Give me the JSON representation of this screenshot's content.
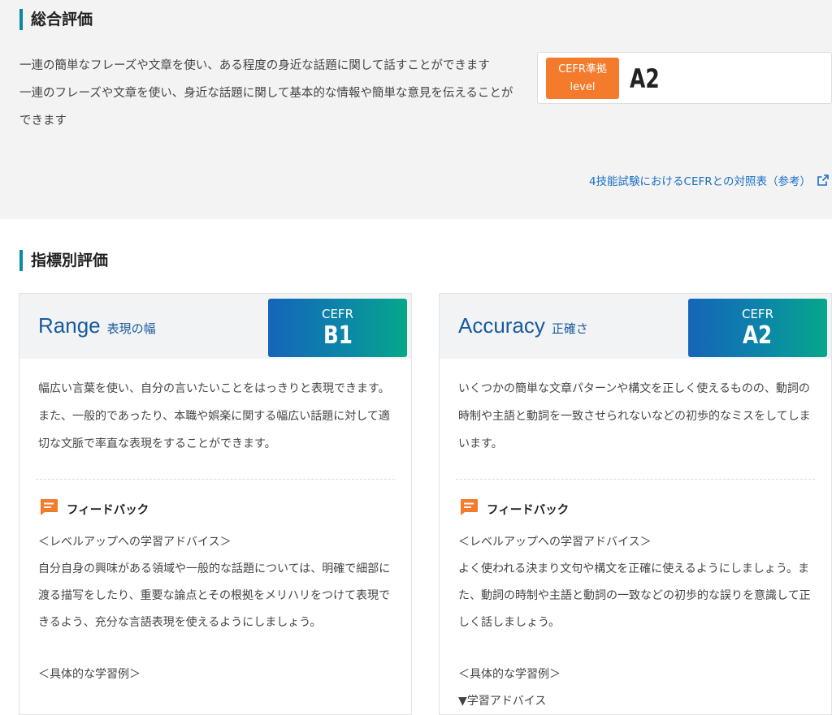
{
  "overall": {
    "heading": "総合評価",
    "desc_line1": "一連の簡単なフレーズや文章を使い、ある程度の身近な話題に関して話すことができます",
    "desc_line2": "一連のフレーズや文章を使い、身近な話題に関して基本的な情報や簡単な意見を伝えることができます",
    "level_tag_line1": "CEFR準拠",
    "level_tag_line2": "level",
    "level_value": "A2",
    "reference_link": "4技能試験におけるCEFRとの対照表（参考）",
    "accent_color": "#f47a2c"
  },
  "indicator": {
    "heading": "指標別評価",
    "cards": [
      {
        "title": "Range",
        "subtitle": "表現の幅",
        "cefr_label": "CEFR",
        "cefr_value": "B1",
        "description": "幅広い言葉を使い、自分の言いたいことをはっきりと表現できます。また、一般的であったり、本職や娯楽に関する幅広い話題に対して適切な文脈で率直な表現をすることができます。",
        "feedback_title": "フィードバック",
        "advice_heading": "＜レベルアップへの学習アドバイス＞",
        "advice_text": "自分自身の興味がある領域や一般的な話題については、明確で細部に渡る描写をしたり、重要な論点とその根拠をメリハリをつけて表現できるよう、充分な言語表現を使えるようにしましょう。",
        "example_heading": "＜具体的な学習例＞",
        "example_text": ""
      },
      {
        "title": "Accuracy",
        "subtitle": "正確さ",
        "cefr_label": "CEFR",
        "cefr_value": "A2",
        "description": "いくつかの簡単な文章パターンや構文を正しく使えるものの、動詞の時制や主語と動詞を一致させられないなどの初歩的なミスをしてしまいます。",
        "feedback_title": "フィードバック",
        "advice_heading": "＜レベルアップへの学習アドバイス＞",
        "advice_text": "よく使われる決まり文句や構文を正確に使えるようにしましょう。また、動詞の時制や主語と動詞の一致などの初歩的な誤りを意識して正しく話しましょう。",
        "example_heading": "＜具体的な学習例＞",
        "example_text": "▼学習アドバイス"
      }
    ],
    "heading_accent": "#0a8a9e",
    "feedback_icon_color": "#f47a2c"
  }
}
